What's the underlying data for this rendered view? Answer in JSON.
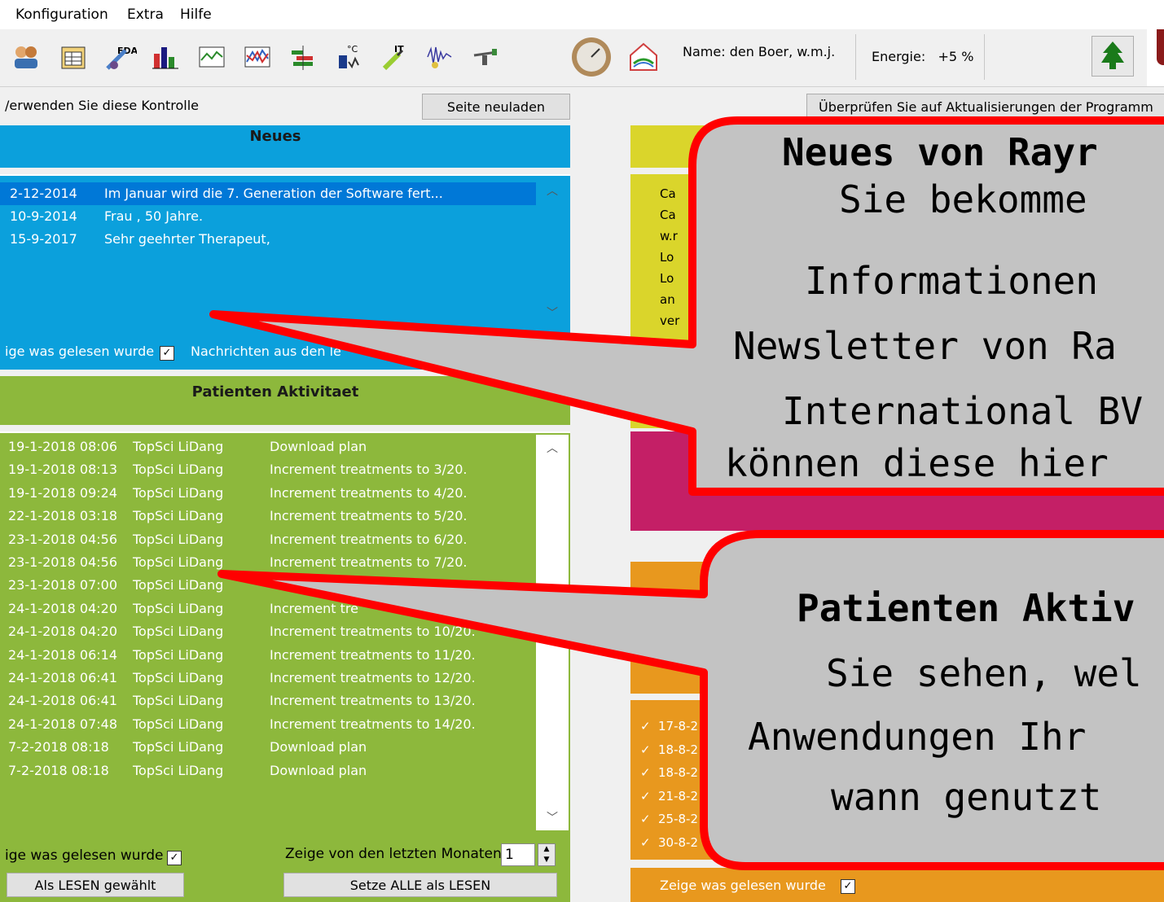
{
  "menu": [
    "Konfiguration",
    "Extra",
    "Hilfe"
  ],
  "toolbar": {
    "icons": [
      "patients-icon",
      "table-icon",
      "eda-icon",
      "bar-chart-icon",
      "line-chart-icon",
      "multi-chart-icon",
      "equalizer-icon",
      "temperature-icon",
      "it-icon",
      "waveform-icon",
      "scale-icon",
      "gauge-icon",
      "health-house-icon"
    ],
    "name_label": "Name:",
    "name_value": "den Boer, w.m.j.",
    "energy_label": "Energie:",
    "energy_value": "+5",
    "energy_unit": "%"
  },
  "topbar": {
    "left_text": "/erwenden Sie diese Kontrolle",
    "reload_button": "Seite neuladen",
    "update_button": "Überprüfen Sie auf Aktualisierungen der Programm"
  },
  "neues": {
    "title": "Neues",
    "items": [
      {
        "date": "2-12-2014",
        "text": "Im Januar wird die 7. Generation der Software fert..."
      },
      {
        "date": "10-9-2014",
        "text": "Frau , 50 Jahre."
      },
      {
        "date": "15-9-2017",
        "text": "Sehr geehrter Therapeut,"
      }
    ],
    "footer_read": "ige was gelesen wurde",
    "footer_messages": "Nachrichten aus den le"
  },
  "patienten": {
    "title": "Patienten Aktivitaet",
    "rows": [
      {
        "date": "19-1-2018 08:06",
        "name": "TopSci LiDang",
        "action": "Download plan"
      },
      {
        "date": "19-1-2018 08:13",
        "name": "TopSci LiDang",
        "action": "Increment treatments to 3/20."
      },
      {
        "date": "19-1-2018 09:24",
        "name": "TopSci LiDang",
        "action": "Increment treatments to 4/20."
      },
      {
        "date": "22-1-2018 03:18",
        "name": "TopSci LiDang",
        "action": "Increment treatments to 5/20."
      },
      {
        "date": "23-1-2018 04:56",
        "name": "TopSci LiDang",
        "action": "Increment treatments to 6/20."
      },
      {
        "date": "23-1-2018 04:56",
        "name": "TopSci LiDang",
        "action": "Increment treatments to 7/20."
      },
      {
        "date": "23-1-2018 07:00",
        "name": "TopSci LiDang",
        "action": ""
      },
      {
        "date": "24-1-2018 04:20",
        "name": "TopSci LiDang",
        "action": "Increment tre"
      },
      {
        "date": "24-1-2018 04:20",
        "name": "TopSci LiDang",
        "action": "Increment treatments to 10/20."
      },
      {
        "date": "24-1-2018 06:14",
        "name": "TopSci LiDang",
        "action": "Increment treatments to 11/20."
      },
      {
        "date": "24-1-2018 06:41",
        "name": "TopSci LiDang",
        "action": "Increment treatments to 12/20."
      },
      {
        "date": "24-1-2018 06:41",
        "name": "TopSci LiDang",
        "action": "Increment treatments to 13/20."
      },
      {
        "date": "24-1-2018 07:48",
        "name": "TopSci LiDang",
        "action": "Increment treatments to 14/20."
      },
      {
        "date": "7-2-2018 08:18",
        "name": "TopSci LiDang",
        "action": "Download plan"
      },
      {
        "date": "7-2-2018 08:18",
        "name": "TopSci LiDang",
        "action": "Download plan"
      }
    ],
    "footer_read": "ige was gelesen wurde",
    "months_label": "Zeige von den letzten Monaten",
    "months_value": "1",
    "mark_selected_button": "Als LESEN gewählt",
    "mark_all_button": "Setze ALLE als LESEN"
  },
  "right": {
    "yellow_lines": [
      "Ca",
      "Ca",
      "w.r",
      "Lo",
      "Lo",
      "an",
      "ver"
    ],
    "orange_items": [
      "17-8-2",
      "18-8-2",
      "18-8-2",
      "21-8-2",
      "25-8-2",
      "30-8-2"
    ],
    "footer_read": "Zeige was gelesen wurde"
  },
  "callout1": {
    "title": "Neues von Rayr",
    "lines": [
      "Sie bekomme",
      "Informationen",
      "Newsletter von Ra",
      "International BV",
      "können diese hier"
    ]
  },
  "callout2": {
    "title": "Patienten Aktiv",
    "lines": [
      "Sie sehen, wel",
      "Anwendungen Ihr",
      "wann genutzt"
    ]
  },
  "colors": {
    "blue": "#0ba0dc",
    "green": "#8db83c",
    "yellow": "#dad52b",
    "magenta": "#c41f66",
    "orange": "#e8981e",
    "callout_fill": "#c3c3c3",
    "callout_border": "#ff0000"
  }
}
